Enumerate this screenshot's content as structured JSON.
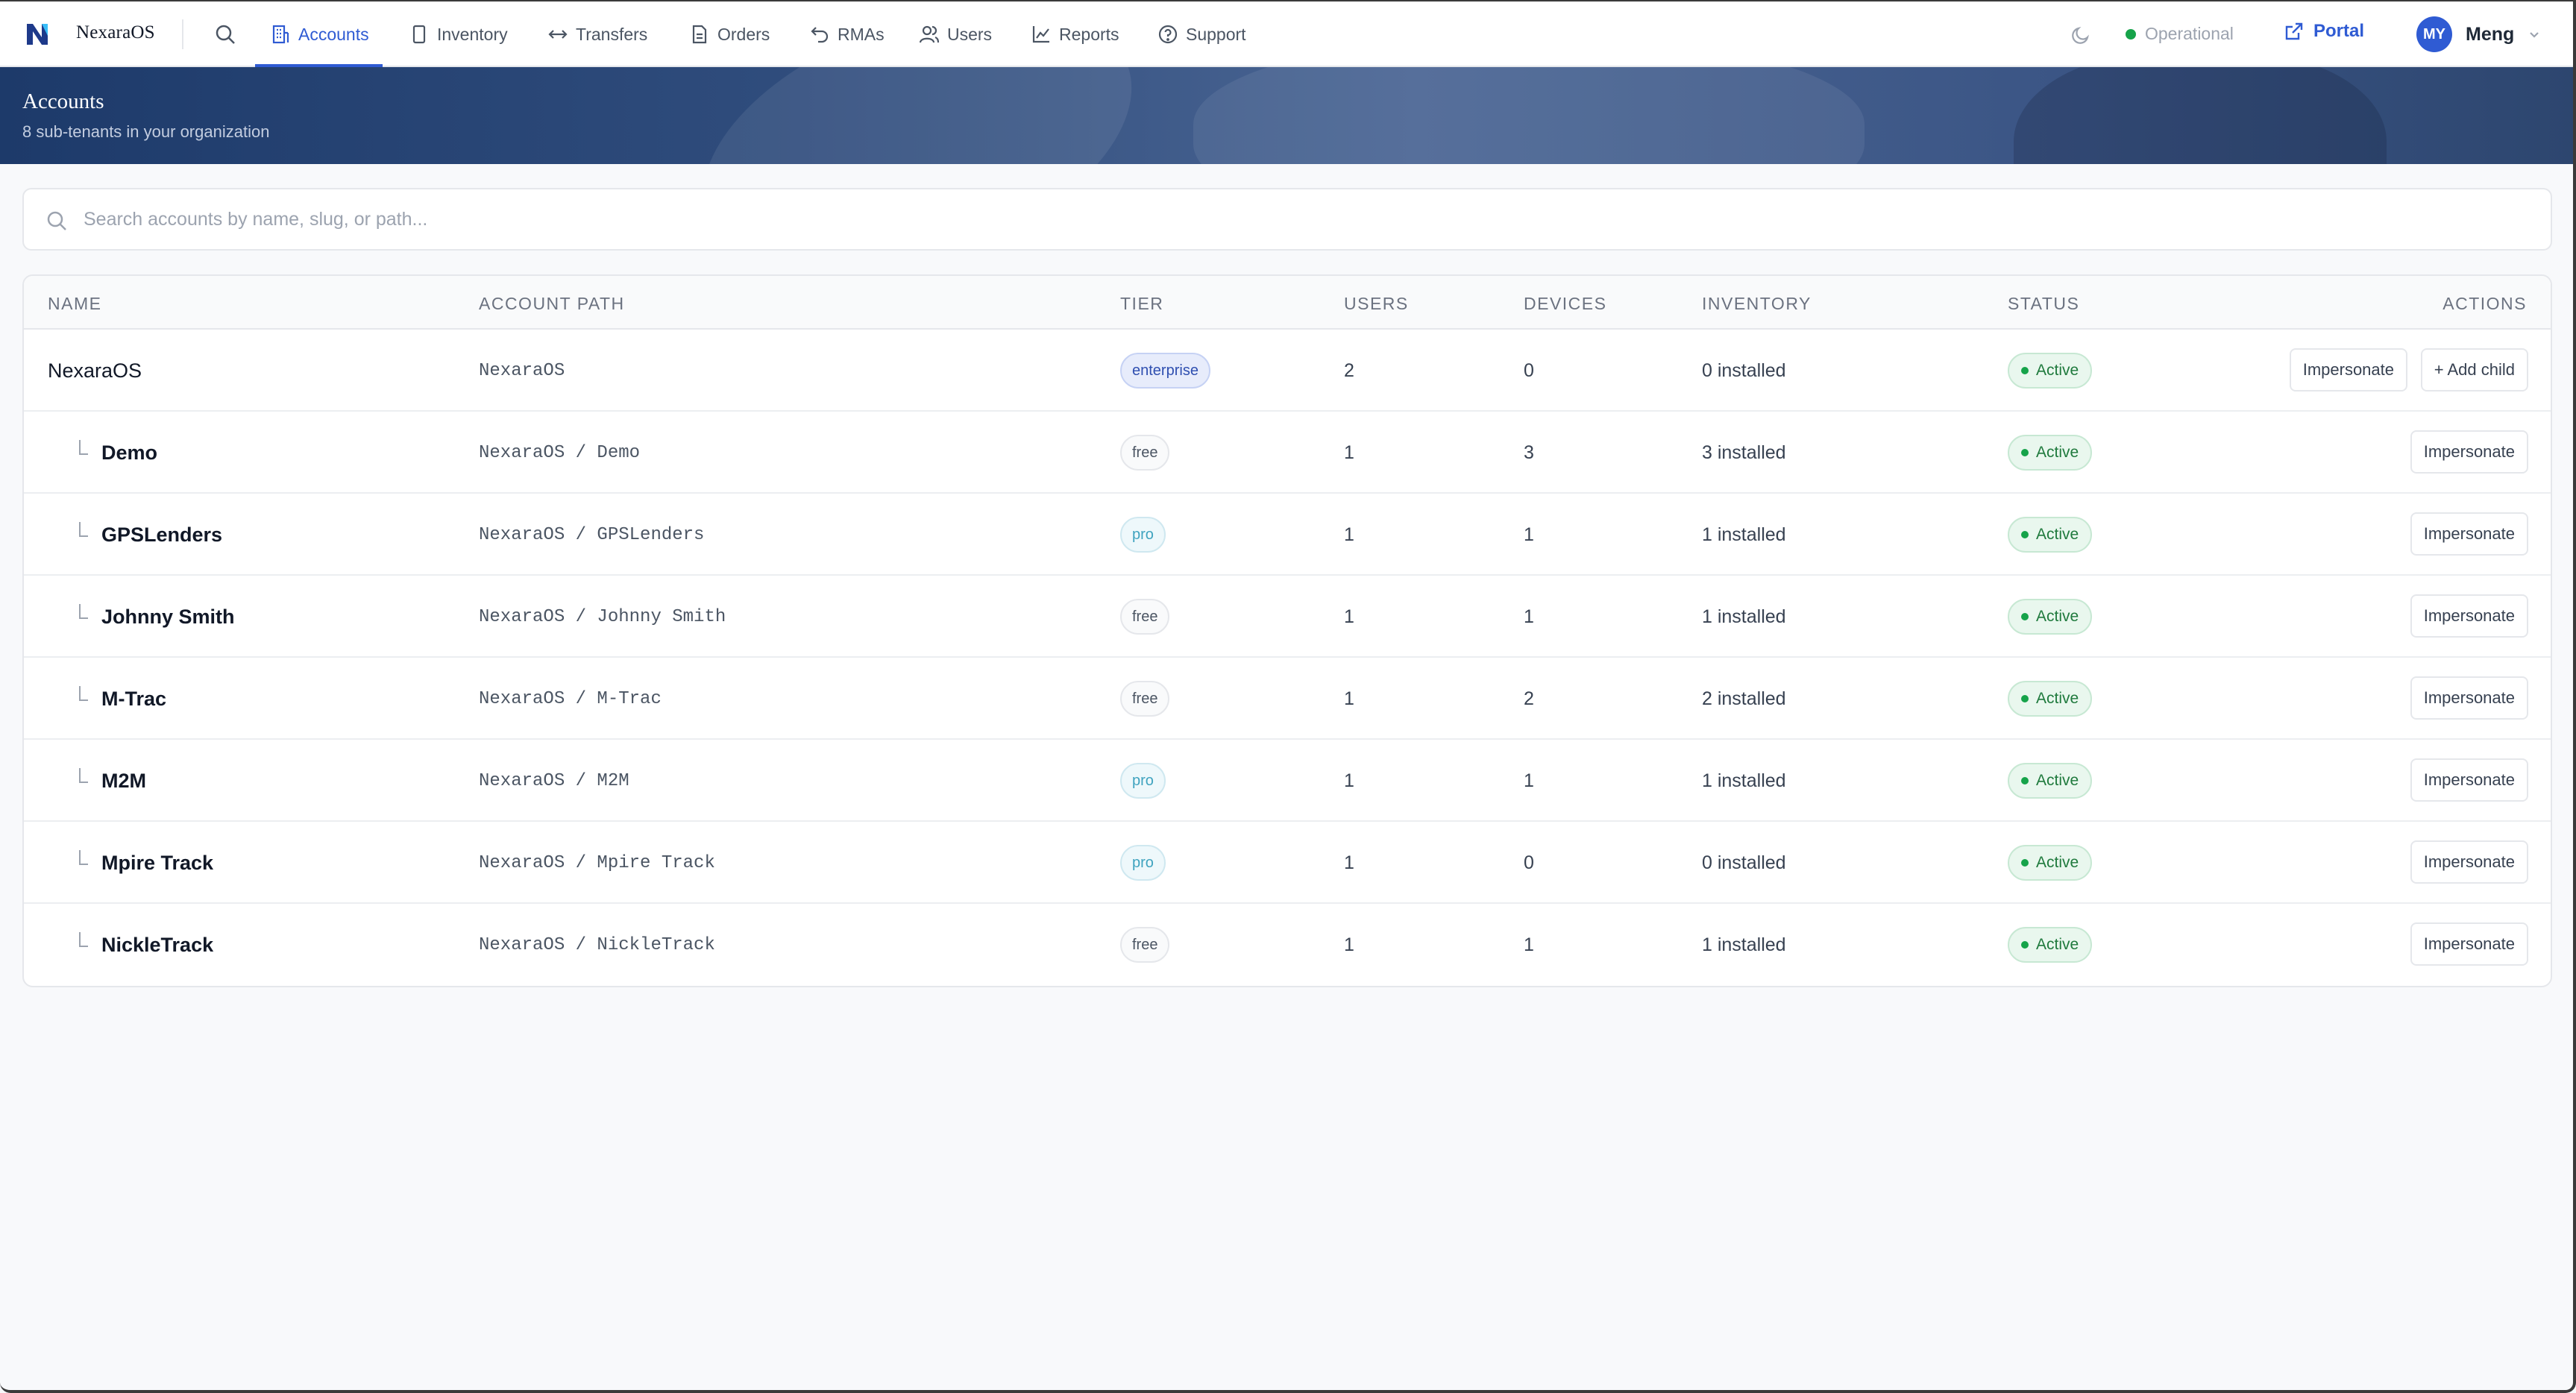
{
  "nav": {
    "brand": "NexaraOS",
    "items": [
      {
        "label": "Accounts",
        "icon": "building-icon",
        "active": true
      },
      {
        "label": "Inventory",
        "icon": "device-icon"
      },
      {
        "label": "Transfers",
        "icon": "transfer-arrows-icon"
      },
      {
        "label": "Orders",
        "icon": "document-icon"
      },
      {
        "label": "RMAs",
        "icon": "return-arrow-icon"
      },
      {
        "label": "Users",
        "icon": "users-icon"
      },
      {
        "label": "Reports",
        "icon": "chart-icon"
      },
      {
        "label": "Support",
        "icon": "help-circle-icon"
      }
    ],
    "status": "Operational",
    "portal": "Portal",
    "user_initials": "MY",
    "user_name": "Meng"
  },
  "hero": {
    "title": "Accounts",
    "subtitle": "8 sub-tenants in your organization"
  },
  "search": {
    "placeholder": "Search accounts by name, slug, or path..."
  },
  "table": {
    "headers": [
      "NAME",
      "ACCOUNT PATH",
      "TIER",
      "USERS",
      "DEVICES",
      "INVENTORY",
      "STATUS",
      "ACTIONS"
    ],
    "rows": [
      {
        "name": "NexaraOS",
        "path": "NexaraOS",
        "tier": "enterprise",
        "users": "2",
        "devices": "0",
        "inventory": "0 installed",
        "status": "Active",
        "child": false,
        "actions": [
          "Impersonate",
          "+ Add child"
        ]
      },
      {
        "name": "Demo",
        "path": "NexaraOS / Demo",
        "tier": "free",
        "users": "1",
        "devices": "3",
        "inventory": "3 installed",
        "status": "Active",
        "child": true,
        "actions": [
          "Impersonate"
        ]
      },
      {
        "name": "GPSLenders",
        "path": "NexaraOS / GPSLenders",
        "tier": "pro",
        "users": "1",
        "devices": "1",
        "inventory": "1 installed",
        "status": "Active",
        "child": true,
        "actions": [
          "Impersonate"
        ]
      },
      {
        "name": "Johnny Smith",
        "path": "NexaraOS / Johnny Smith",
        "tier": "free",
        "users": "1",
        "devices": "1",
        "inventory": "1 installed",
        "status": "Active",
        "child": true,
        "actions": [
          "Impersonate"
        ]
      },
      {
        "name": "M-Trac",
        "path": "NexaraOS / M-Trac",
        "tier": "free",
        "users": "1",
        "devices": "2",
        "inventory": "2 installed",
        "status": "Active",
        "child": true,
        "actions": [
          "Impersonate"
        ]
      },
      {
        "name": "M2M",
        "path": "NexaraOS / M2M",
        "tier": "pro",
        "users": "1",
        "devices": "1",
        "inventory": "1 installed",
        "status": "Active",
        "child": true,
        "actions": [
          "Impersonate"
        ]
      },
      {
        "name": "Mpire Track",
        "path": "NexaraOS / Mpire Track",
        "tier": "pro",
        "users": "1",
        "devices": "0",
        "inventory": "0 installed",
        "status": "Active",
        "child": true,
        "actions": [
          "Impersonate"
        ]
      },
      {
        "name": "NickleTrack",
        "path": "NexaraOS / NickleTrack",
        "tier": "free",
        "users": "1",
        "devices": "1",
        "inventory": "1 installed",
        "status": "Active",
        "child": true,
        "actions": [
          "Impersonate"
        ]
      }
    ]
  },
  "colors": {
    "accent": "#2f5bd3",
    "status_green": "#16a34a"
  }
}
